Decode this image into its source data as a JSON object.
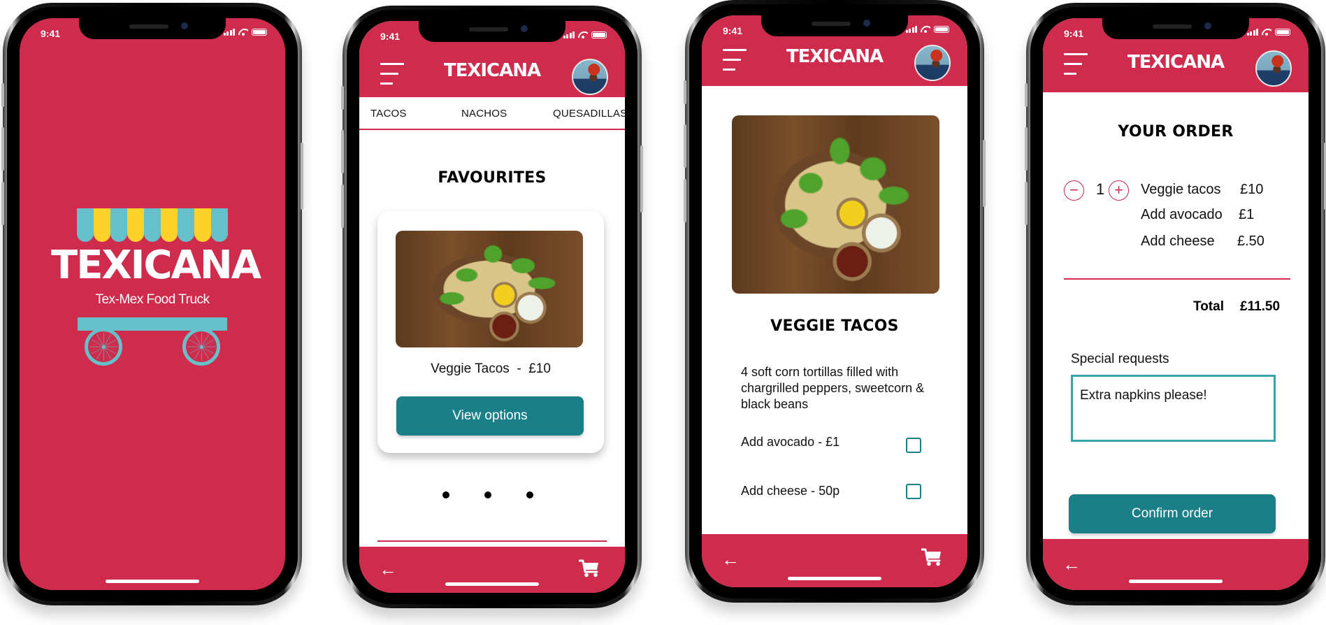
{
  "colors": {
    "brand_red": "#ce2b4d",
    "teal_button": "#1b7f88",
    "awning_teal": "#66c0c9",
    "awning_yellow": "#fdd22a",
    "text": "#111111"
  },
  "status_bar": {
    "time": "9:41"
  },
  "splash": {
    "brand": "TEXICANA",
    "tagline": "Tex-Mex Food Truck"
  },
  "header": {
    "title": "TEXICANA",
    "menu_icon": "hamburger-menu-icon",
    "avatar": "user-avatar"
  },
  "menu_screen": {
    "tabs": [
      {
        "label": "TACOS"
      },
      {
        "label": "NACHOS"
      },
      {
        "label": "QUESADILLAS"
      }
    ],
    "section_title": "FAVOURITES",
    "card": {
      "item_name": "Veggie Tacos",
      "separator": "-",
      "price": "£10",
      "button_label": "View options"
    },
    "carousel_pages": 3
  },
  "detail_screen": {
    "title": "VEGGIE TACOS",
    "description": "4 soft corn tortillas filled with chargrilled peppers, sweetcorn & black beans",
    "options": [
      {
        "label": "Add avocado -  £1",
        "checked": false
      },
      {
        "label": "Add cheese -  50p",
        "checked": false
      }
    ]
  },
  "order_screen": {
    "title": "YOUR ORDER",
    "quantity": "1",
    "minus_label": "−",
    "plus_label": "+",
    "lines": [
      {
        "name": "Veggie tacos",
        "price": "£10"
      },
      {
        "name": "Add avocado",
        "price": "£1"
      },
      {
        "name": "Add cheese",
        "price": "£.50"
      }
    ],
    "total_label": "Total",
    "total_value": "£11.50",
    "special_requests_label": "Special requests",
    "special_requests_value": "Extra napkins please!",
    "confirm_label": "Confirm order"
  },
  "bottom_nav": {
    "back_icon": "←",
    "cart_icon": "shopping-cart-icon"
  }
}
